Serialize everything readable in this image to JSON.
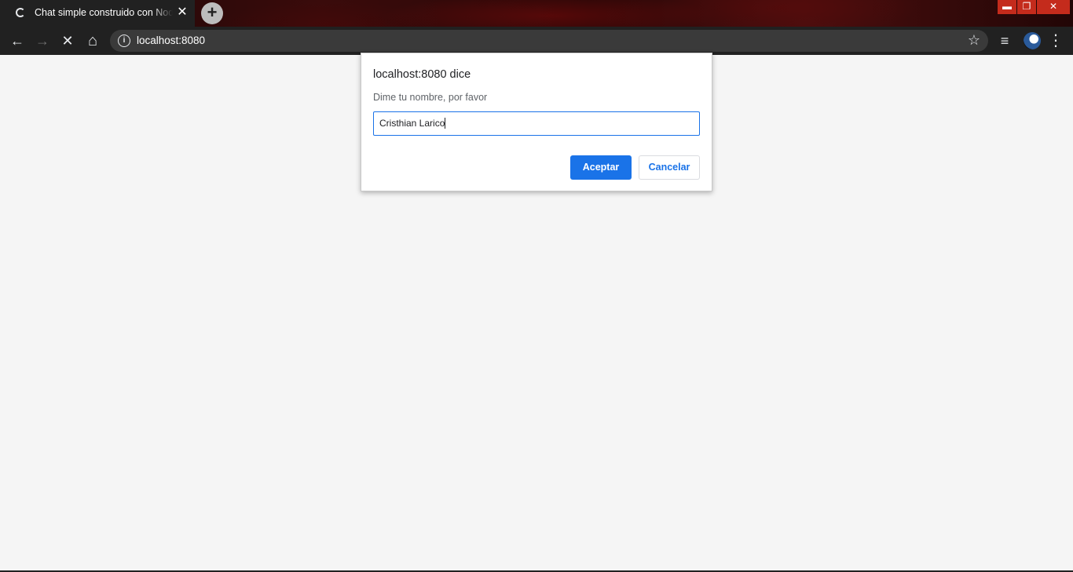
{
  "browser": {
    "tab": {
      "title": "Chat simple construido con Node",
      "close_glyph": "✕"
    },
    "new_tab_glyph": "+",
    "window_controls": {
      "minimize": "▬",
      "maximize": "❐",
      "close": "✕"
    },
    "toolbar": {
      "back_glyph": "←",
      "forward_glyph": "→",
      "stop_glyph": "✕",
      "home_glyph": "⌂",
      "info_glyph": "i",
      "url": "localhost:8080",
      "star_glyph": "☆",
      "media_glyph": "≡",
      "menu_glyph": "⋮"
    }
  },
  "dialog": {
    "title": "localhost:8080 dice",
    "message": "Dime tu nombre, por favor",
    "input_value": "Cristhian Larico",
    "accept_label": "Aceptar",
    "cancel_label": "Cancelar"
  },
  "colors": {
    "accent": "#1a73e8",
    "chrome_bg": "#212121",
    "page_bg": "#f5f5f5",
    "window_control_bg": "#c42b1c"
  }
}
